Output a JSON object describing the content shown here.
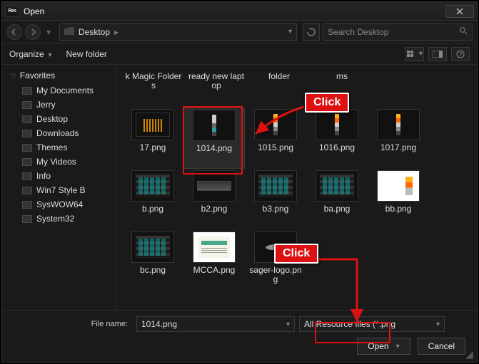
{
  "window": {
    "title": "Open",
    "app_badge": "Res"
  },
  "nav": {
    "breadcrumb": "Desktop",
    "search_placeholder": "Search Desktop"
  },
  "toolbar": {
    "organize": "Organize",
    "new_folder": "New folder"
  },
  "sidebar": {
    "header": "Favorites",
    "items": [
      {
        "label": "My Documents"
      },
      {
        "label": "Jerry"
      },
      {
        "label": "Desktop"
      },
      {
        "label": "Downloads"
      },
      {
        "label": "Themes"
      },
      {
        "label": "My Videos"
      },
      {
        "label": "Info"
      },
      {
        "label": "Win7 Style B"
      },
      {
        "label": "SysWOW64"
      },
      {
        "label": "System32"
      }
    ]
  },
  "files": {
    "row0": [
      {
        "label": "k Magic Folders"
      },
      {
        "label": "ready new laptop"
      },
      {
        "label": "folder"
      },
      {
        "label": "ms"
      }
    ],
    "row1": [
      {
        "label": "17.png"
      },
      {
        "label": "1014.png"
      },
      {
        "label": "1015.png"
      },
      {
        "label": "1016.png"
      },
      {
        "label": "1017.png"
      }
    ],
    "row2": [
      {
        "label": "b.png"
      },
      {
        "label": "b2.png"
      },
      {
        "label": "b3.png"
      },
      {
        "label": "ba.png"
      },
      {
        "label": "bb.png"
      }
    ],
    "row3": [
      {
        "label": "bc.png"
      },
      {
        "label": "MCCA.png"
      },
      {
        "label": "sager-logo.png"
      }
    ]
  },
  "bottom": {
    "filename_label": "File name:",
    "filename_value": "1014.png",
    "filter_value": "All Resource files (*.png",
    "open": "Open",
    "cancel": "Cancel"
  },
  "annotations": {
    "click1": "Click",
    "click2": "Click"
  }
}
